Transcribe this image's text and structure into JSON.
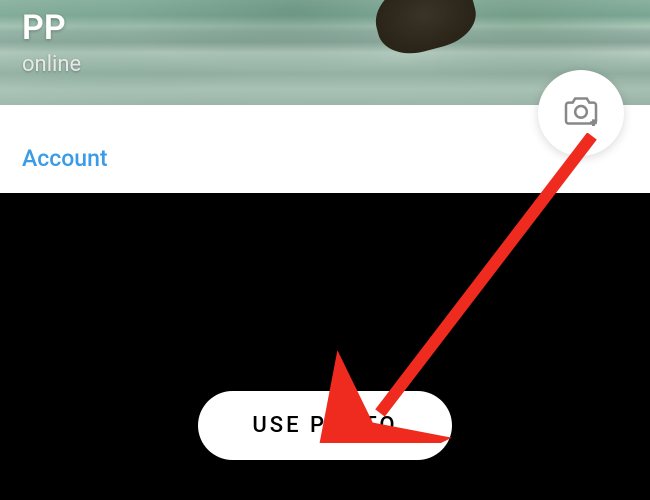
{
  "profile": {
    "name": "PP",
    "status": "online"
  },
  "sections": {
    "account_label": "Account"
  },
  "actions": {
    "use_photo_label": "USE PHOTO"
  },
  "icons": {
    "camera": "camera-add-icon"
  }
}
